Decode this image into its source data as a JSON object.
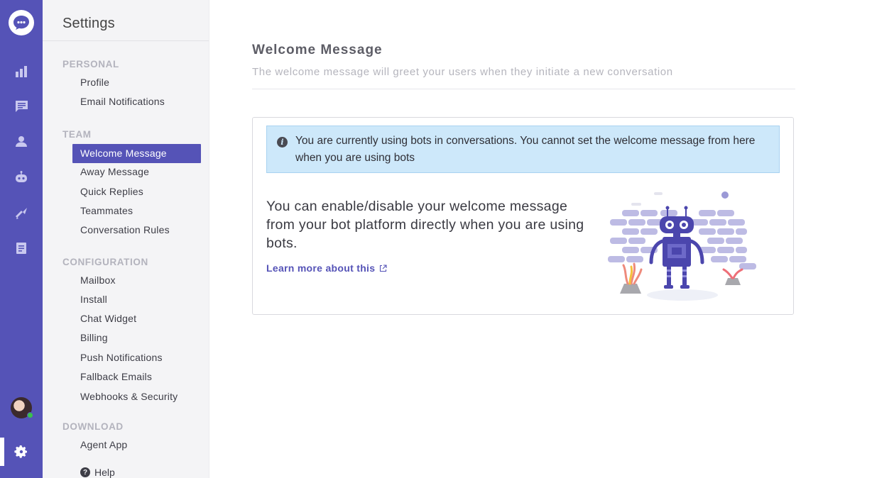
{
  "rail": {
    "icons": [
      "chat-logo-icon",
      "reports-icon",
      "conversations-icon",
      "contacts-icon",
      "bot-icon",
      "campaigns-icon",
      "articles-icon",
      "avatar",
      "settings-icon"
    ]
  },
  "sidebar": {
    "title": "Settings",
    "sections": [
      {
        "heading": "PERSONAL",
        "items": [
          "Profile",
          "Email Notifications"
        ]
      },
      {
        "heading": "TEAM",
        "items": [
          "Welcome Message",
          "Away Message",
          "Quick Replies",
          "Teammates",
          "Conversation Rules"
        ]
      },
      {
        "heading": "CONFIGURATION",
        "items": [
          "Mailbox",
          "Install",
          "Chat Widget",
          "Billing",
          "Push Notifications",
          "Fallback Emails",
          "Webhooks & Security"
        ]
      },
      {
        "heading": "DOWNLOAD",
        "items": [
          "Agent App"
        ]
      }
    ],
    "active_item": "Welcome Message",
    "help": "Help"
  },
  "main": {
    "title": "Welcome Message",
    "subtitle": "The welcome message will greet your users when they initiate a new conversation",
    "notice": "You are currently using bots in conversations. You cannot set the welcome message from here when you are using bots",
    "lead": "You can enable/disable your welcome message from your bot platform directly when you are using bots.",
    "learn_more": "Learn more about this"
  },
  "colors": {
    "brand": "#5553b7",
    "notice_bg": "#cde8fa",
    "link": "#5553b7"
  }
}
